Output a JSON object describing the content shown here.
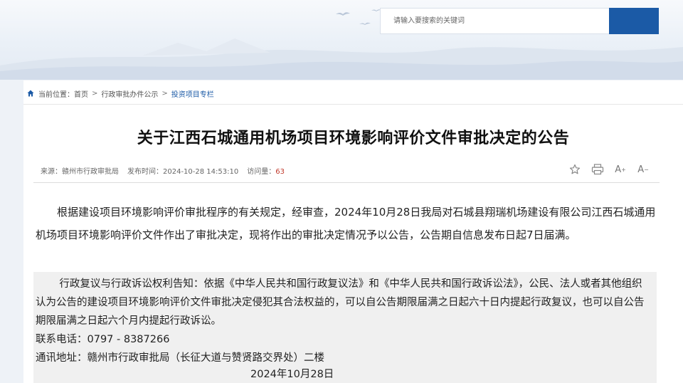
{
  "search": {
    "placeholder": "请输入要搜索的关键词"
  },
  "breadcrumb": {
    "prefix": "当前位置：",
    "items": [
      "首页",
      "行政审批办件公示",
      "投资项目专栏"
    ],
    "separator": ">"
  },
  "article": {
    "title": "关于江西石城通用机场项目环境影响评价文件审批决定的公告",
    "source": "来源：赣州市行政审批局",
    "publish_time": "发布时间：2024-10-28 14:53:10",
    "views_label": "访问量：",
    "views_count": "63",
    "body_paragraph": "根据建设项目环境影响评价审批程序的有关规定，经审查，2024年10月28日我局对石城县翔瑞机场建设有限公司江西石城通用机场项目环境影响评价文件作出了审批决定，现将作出的审批决定情况予以公告，公告期自信息发布日起7日届满。",
    "notice_paragraph": "行政复议与行政诉讼权利告知：依据《中华人民共和国行政复议法》和《中华人民共和国行政诉讼法》，公民、法人或者其他组织认为公告的建设项目环境影响评价文件审批决定侵犯其合法权益的，可以自公告期限届满之日起六十日内提起行政复议，也可以自公告期限届满之日起六个月内提起行政诉讼。",
    "phone": "联系电话：0797 - 8387266",
    "address": "通讯地址：赣州市行政审批局（长征大道与赞贤路交界处）二楼",
    "date": "2024年10月28日"
  },
  "tools": {
    "font_increase": "A",
    "font_decrease": "A"
  },
  "colors": {
    "accent": "#1b5aa6",
    "views": "#c0392b"
  }
}
